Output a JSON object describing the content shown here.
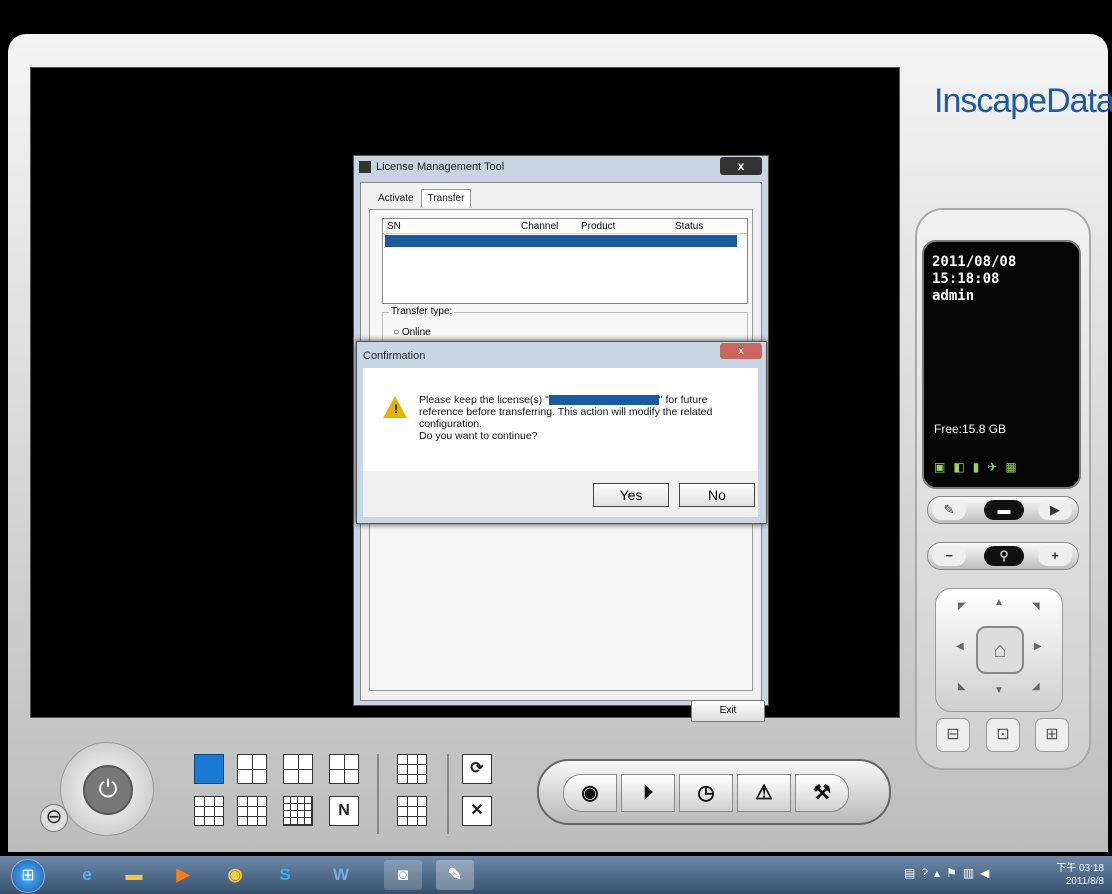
{
  "brand": {
    "name": "InscapeData"
  },
  "status_display": {
    "date": "2011/08/08",
    "time": "15:18:08",
    "user": "admin",
    "free_space": "Free:15.8 GB"
  },
  "license_window": {
    "title": "License Management Tool",
    "close_label": "x",
    "tabs": [
      "Activate",
      "Transfer"
    ],
    "active_tab": "Transfer",
    "columns": [
      "SN",
      "Channel",
      "Product",
      "Status"
    ],
    "transfer_type_label": "Transfer type:",
    "option_online": "Online",
    "exit_label": "Exit"
  },
  "confirmation": {
    "title": "Confirmation",
    "message_prefix": "Please keep the license(s) \"",
    "message_suffix": "\" for future reference before transferring. This action will modify the related configuration.",
    "question": "Do you want to continue?",
    "yes_label": "Yes",
    "no_label": "No"
  },
  "taskbar": {
    "clock_time": "下午 03:18",
    "clock_date": "2011/8/8"
  },
  "colors": {
    "accent": "#1a7ad3",
    "brand": "#1b5aa4",
    "selection": "#1a5aa0"
  },
  "icons": [
    "power-icon",
    "minus-icon",
    "record-icon",
    "playback-icon",
    "schedule-icon",
    "alarm-icon",
    "settings-wrench-icon",
    "home-icon",
    "zoom-icon"
  ]
}
